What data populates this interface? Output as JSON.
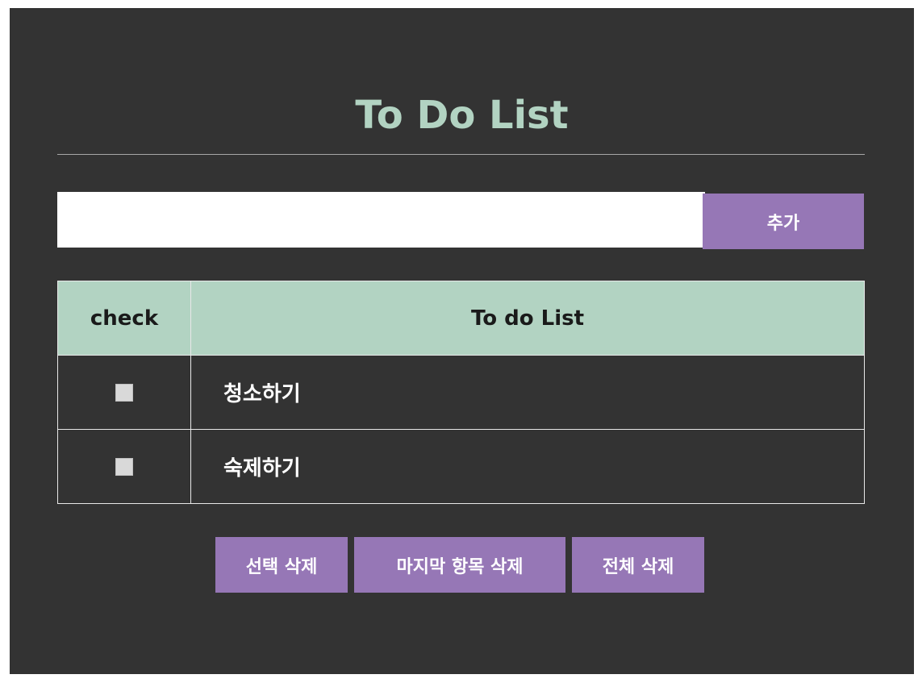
{
  "header": {
    "title": "To Do List"
  },
  "input": {
    "value": "",
    "placeholder": "",
    "add_label": "추가"
  },
  "table": {
    "columns": [
      "check",
      "To do List"
    ],
    "rows": [
      {
        "checked": false,
        "text": "청소하기"
      },
      {
        "checked": false,
        "text": "숙제하기"
      }
    ]
  },
  "actions": {
    "delete_selected": "선택 삭제",
    "delete_last": "마지막 항목 삭제",
    "delete_all": "전체 삭제"
  },
  "colors": {
    "background": "#333333",
    "accent_mint": "#b2d3c2",
    "button_purple": "#9677b6"
  }
}
